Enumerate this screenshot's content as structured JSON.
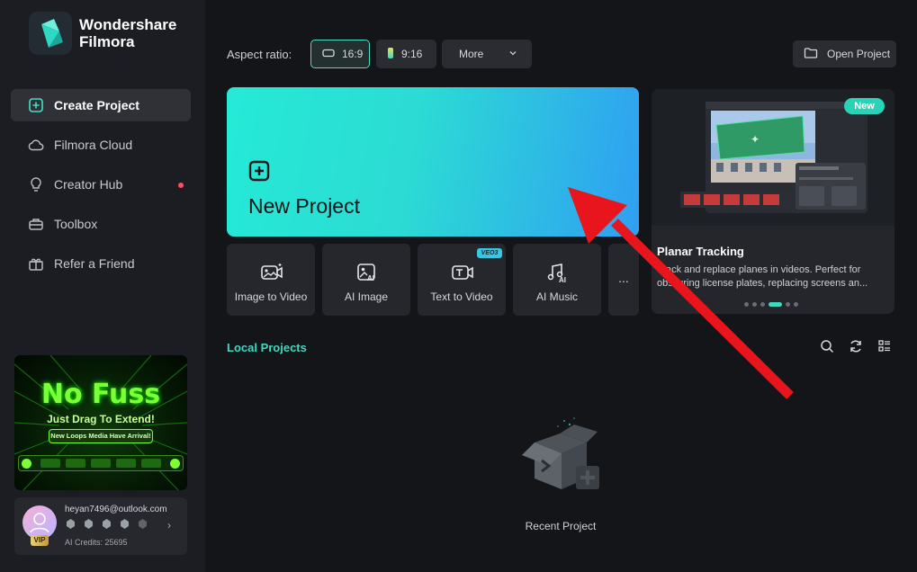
{
  "brand": {
    "line1": "Wondershare",
    "line2": "Filmora"
  },
  "sidebar": {
    "items": [
      {
        "label": "Create Project",
        "icon": "plus-square-icon",
        "active": true
      },
      {
        "label": "Filmora Cloud",
        "icon": "cloud-icon",
        "active": false
      },
      {
        "label": "Creator Hub",
        "icon": "lightbulb-icon",
        "active": false,
        "notification_dot": true
      },
      {
        "label": "Toolbox",
        "icon": "toolbox-icon",
        "active": false
      },
      {
        "label": "Refer a Friend",
        "icon": "gift-icon",
        "active": false
      }
    ],
    "promo": {
      "title": "No Fuss",
      "subtitle": "Just Drag To Extend!",
      "button": "New Loops Media Have Arrival!"
    },
    "user": {
      "email": "heyan7496@outlook.com",
      "vip": "VIP",
      "credits": "AI Credits: 25695"
    }
  },
  "header": {
    "aspect_label": "Aspect ratio:",
    "aspect_options": [
      {
        "label": "16:9",
        "selected": true
      },
      {
        "label": "9:16",
        "selected": false
      }
    ],
    "more_label": "More",
    "open_project_label": "Open Project"
  },
  "new_project": {
    "label": "New Project"
  },
  "tools": [
    {
      "label": "Image to Video",
      "icon": "image-to-video-icon"
    },
    {
      "label": "AI Image",
      "icon": "ai-image-icon"
    },
    {
      "label": "Text to Video",
      "icon": "text-to-video-icon",
      "badge": "VEO3"
    },
    {
      "label": "AI Music",
      "icon": "ai-music-icon"
    }
  ],
  "tools_more": "...",
  "feature": {
    "badge": "New",
    "title": "Planar Tracking",
    "description": "Track and replace planes in videos. Perfect for obscuring license plates, replacing screens an...",
    "active_slide": 4,
    "slide_count": 7
  },
  "local_projects": {
    "title": "Local Projects",
    "empty_label": "Recent Project"
  },
  "colors": {
    "accent": "#3fd9c0",
    "card_gradient_start": "#25ead6",
    "card_gradient_end": "#2f9ff2",
    "annotation_arrow": "#e8161c",
    "notification": "#ff4d5e"
  }
}
